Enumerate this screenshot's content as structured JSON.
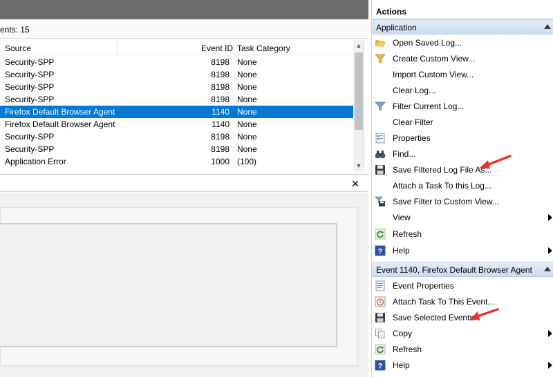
{
  "events_list": {
    "count_text": "ents: 15",
    "columns": {
      "source": "Source",
      "event_id": "Event ID",
      "task_category": "Task Category"
    },
    "rows": [
      {
        "source": "Security-SPP",
        "event_id": "8198",
        "task_category": "None"
      },
      {
        "source": "Security-SPP",
        "event_id": "8198",
        "task_category": "None"
      },
      {
        "source": "Security-SPP",
        "event_id": "8198",
        "task_category": "None"
      },
      {
        "source": "Security-SPP",
        "event_id": "8198",
        "task_category": "None"
      },
      {
        "source": "Firefox Default Browser Agent",
        "event_id": "1140",
        "task_category": "None"
      },
      {
        "source": "Firefox Default Browser Agent",
        "event_id": "1140",
        "task_category": "None"
      },
      {
        "source": "Security-SPP",
        "event_id": "8198",
        "task_category": "None"
      },
      {
        "source": "Security-SPP",
        "event_id": "8198",
        "task_category": "None"
      },
      {
        "source": "Application Error",
        "event_id": "1000",
        "task_category": "(100)"
      }
    ],
    "selected_row_index": 4
  },
  "detail_pane": {
    "close_glyph": "✕"
  },
  "actions": {
    "title": "Actions",
    "application_section": {
      "header": "Application",
      "items": [
        {
          "label": "Open Saved Log...",
          "icon": "folder-open-icon"
        },
        {
          "label": "Create Custom View...",
          "icon": "funnel-icon"
        },
        {
          "label": "Import Custom View...",
          "icon": "none"
        },
        {
          "label": "Clear Log...",
          "icon": "none"
        },
        {
          "label": "Filter Current Log...",
          "icon": "filter-icon"
        },
        {
          "label": "Clear Filter",
          "icon": "none"
        },
        {
          "label": "Properties",
          "icon": "properties-icon"
        },
        {
          "label": "Find...",
          "icon": "binoculars-icon"
        },
        {
          "label": "Save Filtered Log File As...",
          "icon": "floppy-disk-icon"
        },
        {
          "label": "Attach a Task To this Log...",
          "icon": "none"
        },
        {
          "label": "Save Filter to Custom View...",
          "icon": "save-filter-icon"
        },
        {
          "label": "View",
          "icon": "none",
          "submenu": true
        },
        {
          "label": "Refresh",
          "icon": "refresh-icon"
        },
        {
          "label": "Help",
          "icon": "help-icon",
          "submenu": true
        }
      ]
    },
    "event_section": {
      "header": "Event 1140, Firefox Default Browser Agent",
      "items": [
        {
          "label": "Event Properties",
          "icon": "event-properties-icon"
        },
        {
          "label": "Attach Task To This Event...",
          "icon": "task-clock-icon"
        },
        {
          "label": "Save Selected Events...",
          "icon": "floppy-disk-icon"
        },
        {
          "label": "Copy",
          "icon": "copy-icon",
          "submenu": true
        },
        {
          "label": "Refresh",
          "icon": "refresh-icon"
        },
        {
          "label": "Help",
          "icon": "help-icon",
          "submenu": true
        }
      ]
    }
  },
  "colors": {
    "selection": "#0078d7",
    "section_header": "#d5e2f1",
    "annotation_arrow": "#e8342f"
  }
}
